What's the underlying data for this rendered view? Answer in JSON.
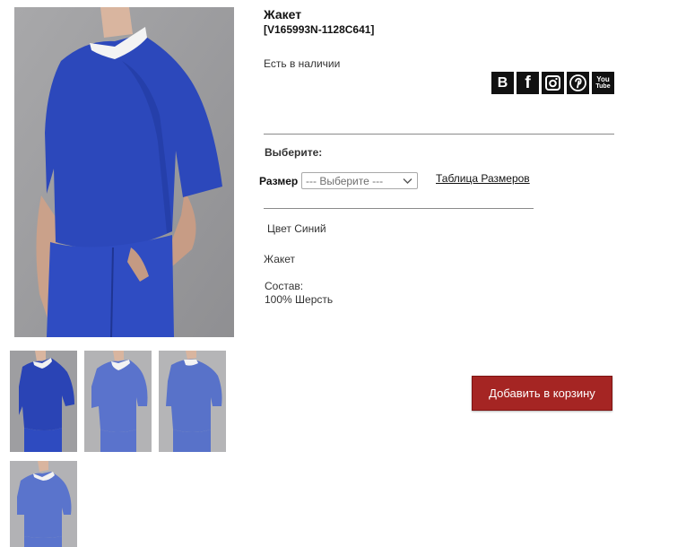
{
  "product": {
    "title": "Жакет",
    "sku": "[V165993N-1128C641]",
    "availability": "Есть в наличии"
  },
  "social": {
    "icons": [
      "vk-icon",
      "facebook-icon",
      "instagram-icon",
      "pinterest-icon",
      "youtube-icon"
    ],
    "vk_letter": "B",
    "fb_letter": "f",
    "yt_line1": "You",
    "yt_line2": "Tube"
  },
  "options": {
    "choose_label": "Выберите:",
    "size_label": "Размер",
    "size_select_value": "--- Выберите ---",
    "size_table_link": "Таблица Размеров"
  },
  "details": {
    "color": "Цвет Синий",
    "type": "Жакет",
    "composition_label": "Состав:",
    "composition_value": "100% Шерсть"
  },
  "cart": {
    "button_label": "Добавить в корзину",
    "button_color": "#a52523"
  },
  "colors": {
    "garment_main": "#2a46b8",
    "garment_light": "#5a73cc",
    "photo_background": "#9d9d9f"
  }
}
